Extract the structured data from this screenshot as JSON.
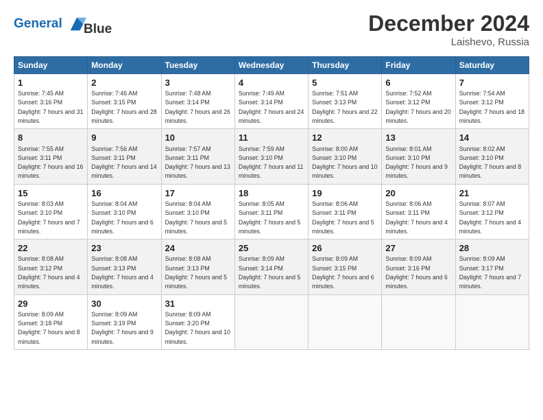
{
  "header": {
    "logo_line1": "General",
    "logo_line2": "Blue",
    "month": "December 2024",
    "location": "Laishevo, Russia"
  },
  "days_of_week": [
    "Sunday",
    "Monday",
    "Tuesday",
    "Wednesday",
    "Thursday",
    "Friday",
    "Saturday"
  ],
  "weeks": [
    [
      {
        "day": "1",
        "sunrise": "7:45 AM",
        "sunset": "3:16 PM",
        "daylight": "7 hours and 31 minutes."
      },
      {
        "day": "2",
        "sunrise": "7:46 AM",
        "sunset": "3:15 PM",
        "daylight": "7 hours and 28 minutes."
      },
      {
        "day": "3",
        "sunrise": "7:48 AM",
        "sunset": "3:14 PM",
        "daylight": "7 hours and 26 minutes."
      },
      {
        "day": "4",
        "sunrise": "7:49 AM",
        "sunset": "3:14 PM",
        "daylight": "7 hours and 24 minutes."
      },
      {
        "day": "5",
        "sunrise": "7:51 AM",
        "sunset": "3:13 PM",
        "daylight": "7 hours and 22 minutes."
      },
      {
        "day": "6",
        "sunrise": "7:52 AM",
        "sunset": "3:12 PM",
        "daylight": "7 hours and 20 minutes."
      },
      {
        "day": "7",
        "sunrise": "7:54 AM",
        "sunset": "3:12 PM",
        "daylight": "7 hours and 18 minutes."
      }
    ],
    [
      {
        "day": "8",
        "sunrise": "7:55 AM",
        "sunset": "3:11 PM",
        "daylight": "7 hours and 16 minutes."
      },
      {
        "day": "9",
        "sunrise": "7:56 AM",
        "sunset": "3:11 PM",
        "daylight": "7 hours and 14 minutes."
      },
      {
        "day": "10",
        "sunrise": "7:57 AM",
        "sunset": "3:11 PM",
        "daylight": "7 hours and 13 minutes."
      },
      {
        "day": "11",
        "sunrise": "7:59 AM",
        "sunset": "3:10 PM",
        "daylight": "7 hours and 11 minutes."
      },
      {
        "day": "12",
        "sunrise": "8:00 AM",
        "sunset": "3:10 PM",
        "daylight": "7 hours and 10 minutes."
      },
      {
        "day": "13",
        "sunrise": "8:01 AM",
        "sunset": "3:10 PM",
        "daylight": "7 hours and 9 minutes."
      },
      {
        "day": "14",
        "sunrise": "8:02 AM",
        "sunset": "3:10 PM",
        "daylight": "7 hours and 8 minutes."
      }
    ],
    [
      {
        "day": "15",
        "sunrise": "8:03 AM",
        "sunset": "3:10 PM",
        "daylight": "7 hours and 7 minutes."
      },
      {
        "day": "16",
        "sunrise": "8:04 AM",
        "sunset": "3:10 PM",
        "daylight": "7 hours and 6 minutes."
      },
      {
        "day": "17",
        "sunrise": "8:04 AM",
        "sunset": "3:10 PM",
        "daylight": "7 hours and 5 minutes."
      },
      {
        "day": "18",
        "sunrise": "8:05 AM",
        "sunset": "3:11 PM",
        "daylight": "7 hours and 5 minutes."
      },
      {
        "day": "19",
        "sunrise": "8:06 AM",
        "sunset": "3:11 PM",
        "daylight": "7 hours and 5 minutes."
      },
      {
        "day": "20",
        "sunrise": "8:06 AM",
        "sunset": "3:11 PM",
        "daylight": "7 hours and 4 minutes."
      },
      {
        "day": "21",
        "sunrise": "8:07 AM",
        "sunset": "3:12 PM",
        "daylight": "7 hours and 4 minutes."
      }
    ],
    [
      {
        "day": "22",
        "sunrise": "8:08 AM",
        "sunset": "3:12 PM",
        "daylight": "7 hours and 4 minutes."
      },
      {
        "day": "23",
        "sunrise": "8:08 AM",
        "sunset": "3:13 PM",
        "daylight": "7 hours and 4 minutes."
      },
      {
        "day": "24",
        "sunrise": "8:08 AM",
        "sunset": "3:13 PM",
        "daylight": "7 hours and 5 minutes."
      },
      {
        "day": "25",
        "sunrise": "8:09 AM",
        "sunset": "3:14 PM",
        "daylight": "7 hours and 5 minutes."
      },
      {
        "day": "26",
        "sunrise": "8:09 AM",
        "sunset": "3:15 PM",
        "daylight": "7 hours and 6 minutes."
      },
      {
        "day": "27",
        "sunrise": "8:09 AM",
        "sunset": "3:16 PM",
        "daylight": "7 hours and 6 minutes."
      },
      {
        "day": "28",
        "sunrise": "8:09 AM",
        "sunset": "3:17 PM",
        "daylight": "7 hours and 7 minutes."
      }
    ],
    [
      {
        "day": "29",
        "sunrise": "8:09 AM",
        "sunset": "3:18 PM",
        "daylight": "7 hours and 8 minutes."
      },
      {
        "day": "30",
        "sunrise": "8:09 AM",
        "sunset": "3:19 PM",
        "daylight": "7 hours and 9 minutes."
      },
      {
        "day": "31",
        "sunrise": "8:09 AM",
        "sunset": "3:20 PM",
        "daylight": "7 hours and 10 minutes."
      },
      null,
      null,
      null,
      null
    ]
  ]
}
